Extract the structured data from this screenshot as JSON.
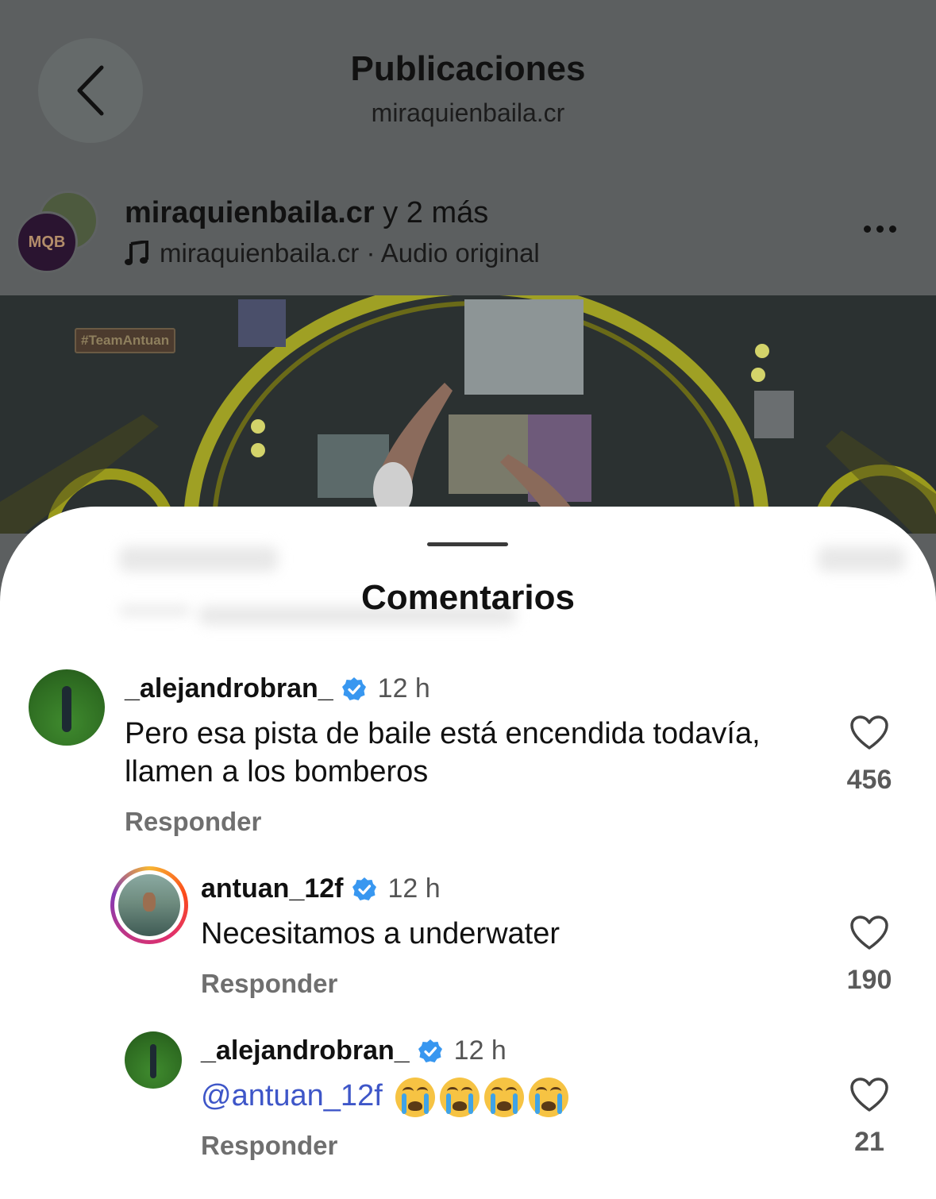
{
  "header": {
    "title": "Publicaciones",
    "subtitle": "miraquienbaila.cr"
  },
  "post": {
    "author_line_user": "miraquienbaila.cr",
    "author_line_rest": " y 2 más",
    "avatar_text": "MQB",
    "audio_label": "miraquienbaila.cr · Audio original",
    "video_tag": "#TeamAntuan"
  },
  "sheet": {
    "title": "Comentarios"
  },
  "comments": [
    {
      "username": "_alejandrobran_",
      "time": "12 h",
      "text": "Pero esa pista de baile está encendida todavía, llamen a los bomberos",
      "reply_label": "Responder",
      "likes": "456"
    },
    {
      "username": "antuan_12f",
      "time": "12 h",
      "text": "Necesitamos a underwater",
      "reply_label": "Responder",
      "likes": "190"
    },
    {
      "username": "_alejandrobran_",
      "time": "12 h",
      "mention": "@antuan_12f",
      "emoji_name": "loudly-crying-face",
      "emoji_count": 4,
      "reply_label": "Responder",
      "likes": "21"
    }
  ],
  "colors": {
    "verified": "#3897f0",
    "mention": "#3e56c8",
    "overlay": "#5c5f60"
  }
}
